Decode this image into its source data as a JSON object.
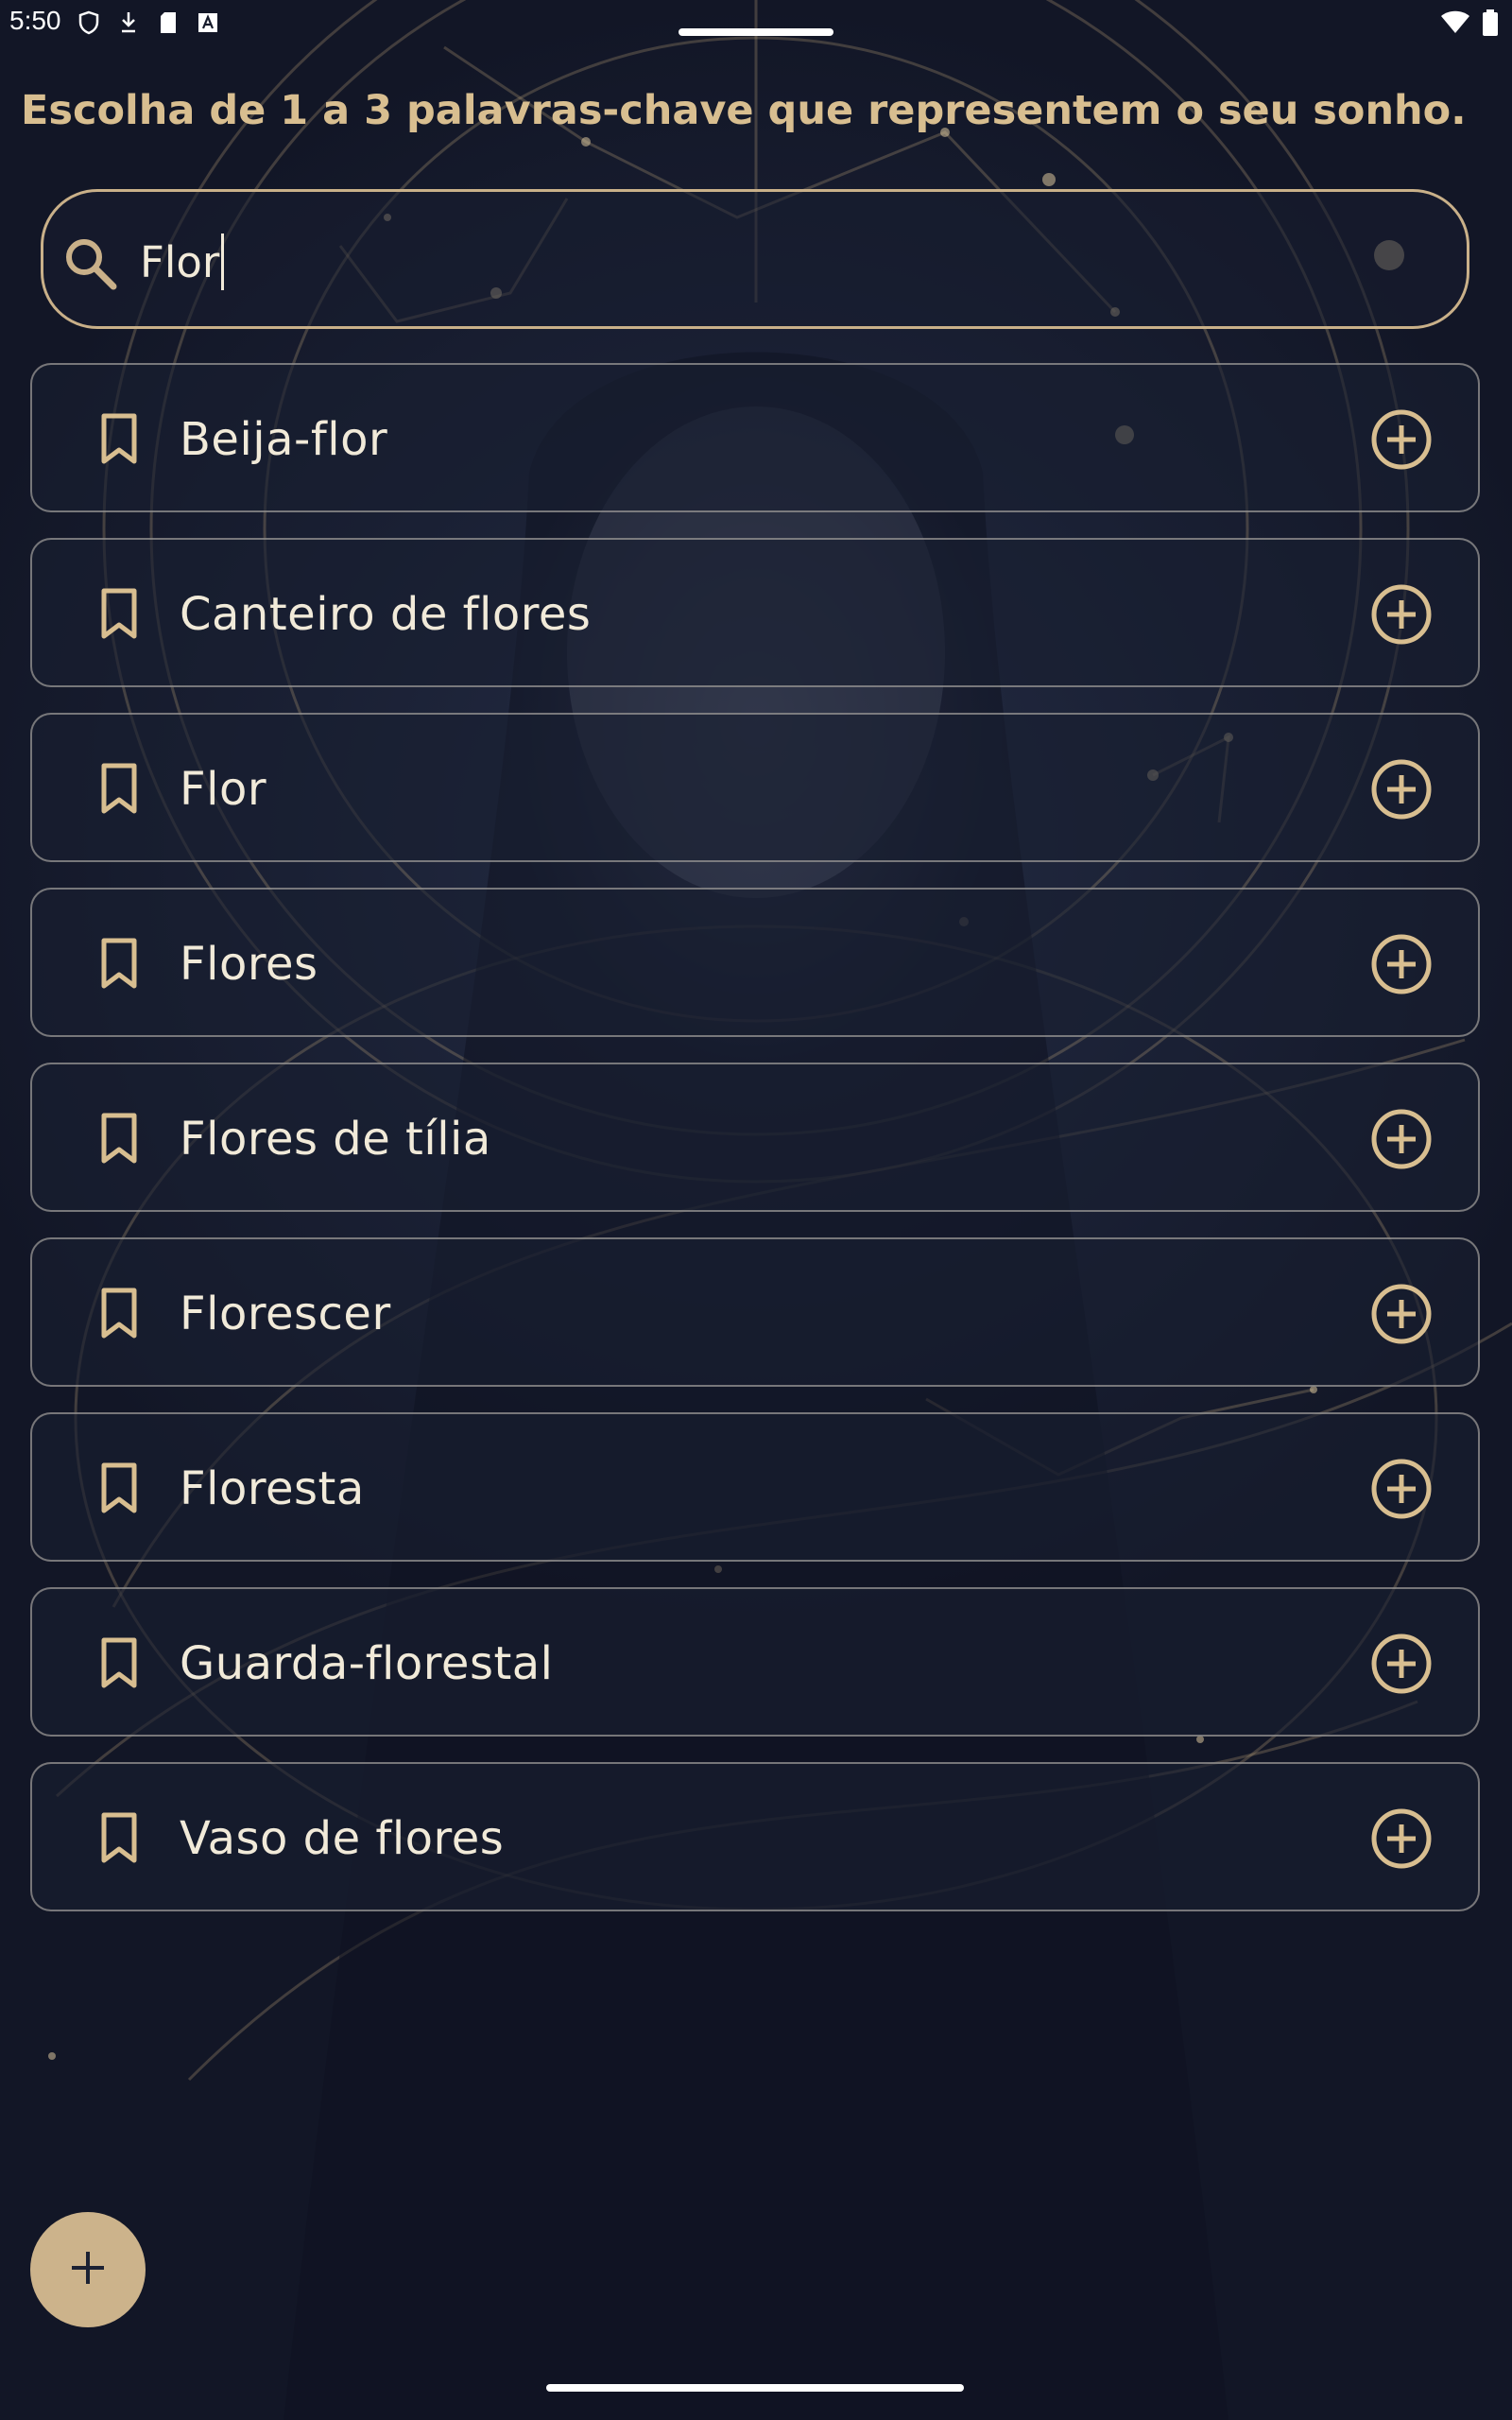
{
  "status_bar": {
    "time": "5:50",
    "left_icons": [
      "shield-icon",
      "download-arrow-icon",
      "sd-card-icon",
      "font-a-icon"
    ],
    "right_icons": [
      "wifi-icon",
      "battery-icon"
    ]
  },
  "prompt": "Escolha de 1 a 3 palavras-chave que representem o seu sonho.",
  "search": {
    "value": "Flor",
    "icon": "search-icon"
  },
  "results": [
    {
      "label": "Beija-flor"
    },
    {
      "label": "Canteiro de flores"
    },
    {
      "label": "Flor"
    },
    {
      "label": "Flores"
    },
    {
      "label": "Flores de tília"
    },
    {
      "label": "Florescer"
    },
    {
      "label": "Floresta"
    },
    {
      "label": "Guarda-florestal"
    },
    {
      "label": "Vaso de flores"
    }
  ],
  "fab": {
    "icon": "plus-icon"
  },
  "colors": {
    "accent": "#d8be90",
    "fab": "#ccb38b",
    "background": "#161b2b",
    "text": "#f1ead9"
  }
}
